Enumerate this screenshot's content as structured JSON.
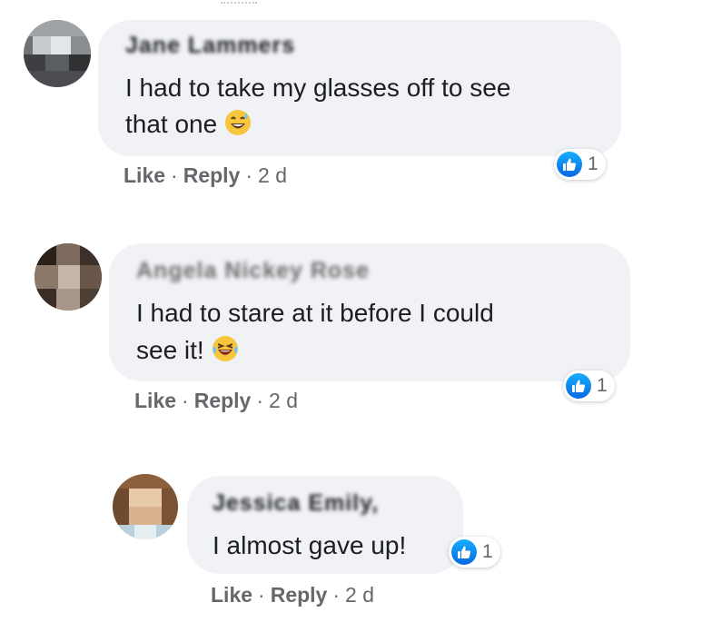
{
  "comments": [
    {
      "author": "Jane Lammers",
      "text_lines": [
        "I had to take my glasses off to see",
        "that one"
      ],
      "emoji": "grinning-sweat-emoji",
      "reaction_count": "1",
      "like_label": "Like",
      "reply_label": "Reply",
      "time": "2 d"
    },
    {
      "author": "Angela Nickey Rose",
      "text_lines": [
        "I had to stare at it before I could",
        "see it!"
      ],
      "emoji": "laughing-tears-emoji",
      "reaction_count": "1",
      "like_label": "Like",
      "reply_label": "Reply",
      "time": "2 d"
    },
    {
      "author": "Jessica Emily,",
      "text_lines": [
        "I almost gave up!"
      ],
      "emoji": "",
      "reaction_count": "1",
      "like_label": "Like",
      "reply_label": "Reply",
      "time": "2 d"
    }
  ],
  "colors": {
    "bubble": "#f0f2f5",
    "like_blue": "#1877f2",
    "meta_gray": "#65676b"
  }
}
